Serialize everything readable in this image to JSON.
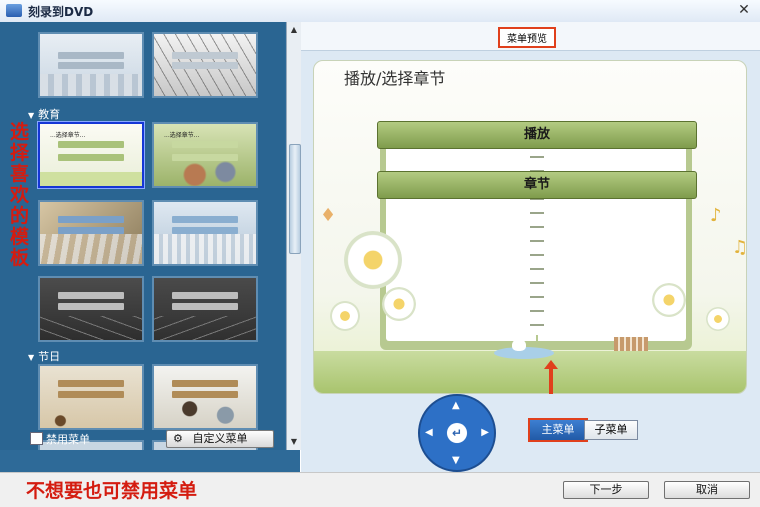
{
  "window": {
    "title": "刻录到DVD",
    "close_glyph": "✕"
  },
  "left": {
    "categories": [
      {
        "label": "教育"
      },
      {
        "label": "节日"
      }
    ],
    "templates_caption": "...选择章节...",
    "disable_menu_label": "禁用菜单",
    "custom_menu_label": "自定义菜单"
  },
  "preview": {
    "header_label": "菜单预览",
    "title": "播放/选择章节",
    "play_button": "播放",
    "chapter_button": "章节",
    "dpad_center": "↵"
  },
  "menu_tabs": {
    "main": "主菜单",
    "sub": "子菜单"
  },
  "annotations": {
    "left": "选择喜欢的模板",
    "bottom": "不想要也可禁用菜单"
  },
  "footer": {
    "next": "下一步",
    "cancel": "取消"
  },
  "colors": {
    "panel_blue": "#2e6a98",
    "annotation_red": "#d41c10",
    "highlight_border": "#e0401c"
  }
}
